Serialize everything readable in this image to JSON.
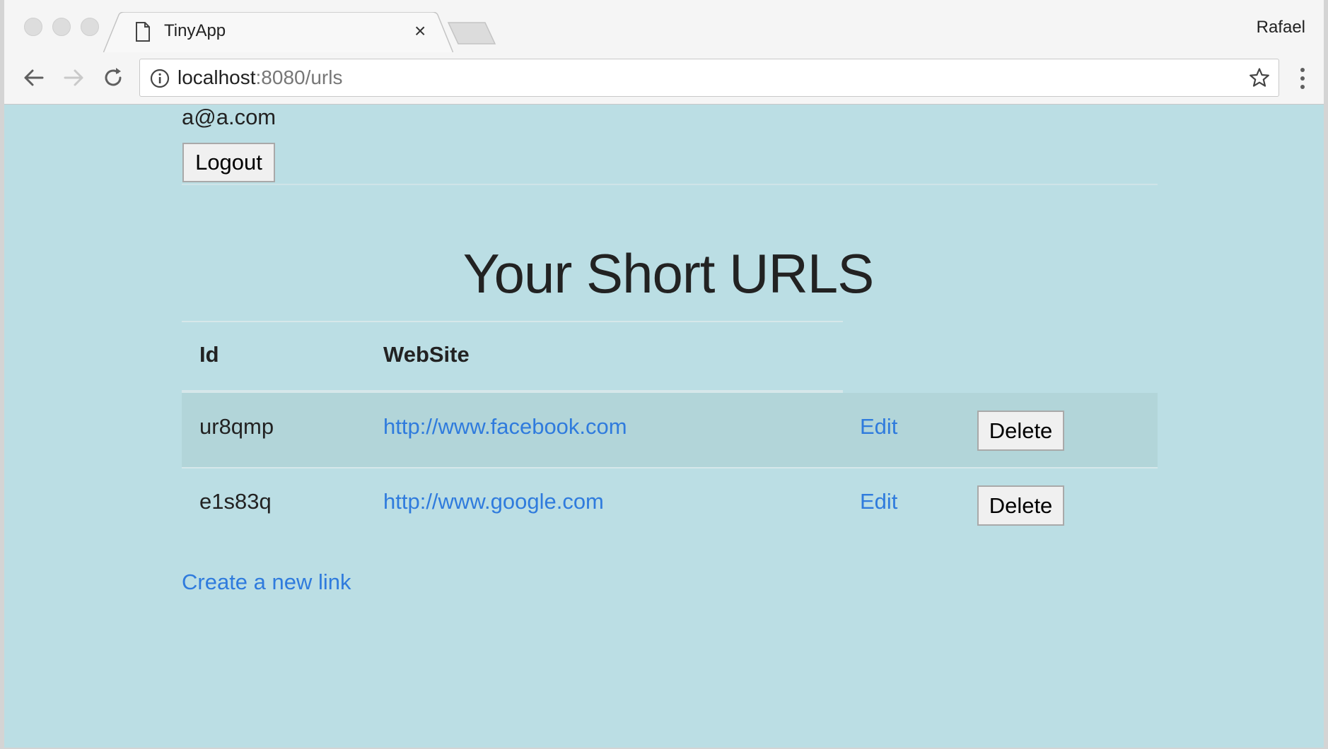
{
  "browser": {
    "tab_title": "TinyApp",
    "tab_close_glyph": "×",
    "profile_name": "Rafael",
    "url_host": "localhost",
    "url_rest": ":8080/urls",
    "icons": [
      "page-icon",
      "close-icon",
      "back-icon",
      "forward-icon",
      "reload-icon",
      "info-icon",
      "star-icon",
      "menu-icon"
    ]
  },
  "header": {
    "user_email": "a@a.com",
    "logout_label": "Logout"
  },
  "main": {
    "title": "Your Short URLS",
    "columns": [
      "Id",
      "WebSite"
    ],
    "rows": [
      {
        "id": "ur8qmp",
        "website": "http://www.facebook.com",
        "edit_label": "Edit",
        "delete_label": "Delete"
      },
      {
        "id": "e1s83q",
        "website": "http://www.google.com",
        "edit_label": "Edit",
        "delete_label": "Delete"
      }
    ],
    "create_link": "Create a new link"
  },
  "colors": {
    "page_background": "#bbdee4",
    "link": "#2f7bdd",
    "highlight_row": "#b2d5d9"
  }
}
